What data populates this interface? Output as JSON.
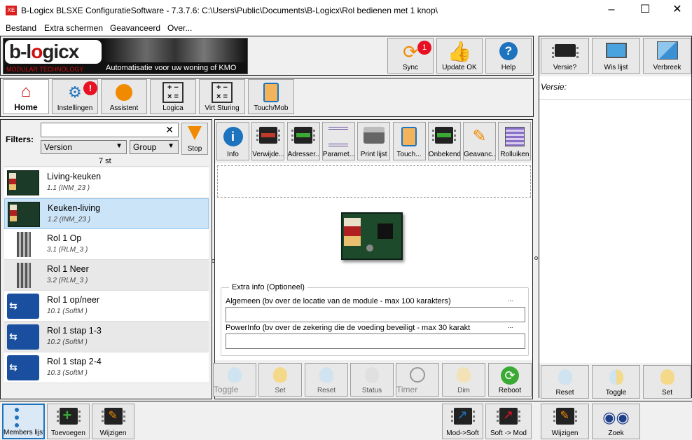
{
  "window": {
    "title": "B-Logicx BLSXE ConfiguratieSoftware - 7.3.7.6: C:\\Users\\Public\\Documents\\B-Logicx\\Rol bedienen met 1 knop\\",
    "icon": "XE",
    "minimize": "–",
    "maximize": "☐",
    "close": "✕"
  },
  "menu": [
    "Bestand",
    "Extra schermen",
    "Geavanceerd",
    "Over..."
  ],
  "logo": {
    "text": "b-l",
    "text2": "gicx",
    "subtitle": "MODULAR TECHNOLOGY",
    "slogan": "Automatisatie voor uw woning of KMO"
  },
  "topbuttons": {
    "sync": "Sync",
    "sync_badge": "1",
    "update": "Update OK",
    "help": "Help"
  },
  "rightbuttons": {
    "versie": "Versie?",
    "wis": "Wis lijst",
    "verbreek": "Verbreek"
  },
  "versie_label": "Versie:",
  "nav": {
    "home": "Home",
    "instellingen": "Instellingen",
    "assistent": "Assistent",
    "logica": "Logica",
    "virt": "Virt Sturing",
    "touch": "Touch/Mob",
    "badge": "!"
  },
  "filters": {
    "label": "Filters:",
    "search_value": "",
    "clear": "✕",
    "version": "Version",
    "group": "Group",
    "stop": "Stop",
    "count": "7 st"
  },
  "modules": [
    {
      "name": "Living-keuken",
      "sub": "1.1 (INM_23 )",
      "type": "inm"
    },
    {
      "name": "Keuken-living",
      "sub": "1.2 (INM_23 )",
      "type": "inm"
    },
    {
      "name": "Rol 1 Op",
      "sub": "3.1 (RLM_3 )",
      "type": "rlm"
    },
    {
      "name": "Rol 1 Neer",
      "sub": "3.2 (RLM_3 )",
      "type": "rlm"
    },
    {
      "name": "Rol 1 op/neer",
      "sub": "10.1 (SoftM )",
      "type": "soft"
    },
    {
      "name": "Rol 1 stap 1-3",
      "sub": "10.2 (SoftM )",
      "type": "soft"
    },
    {
      "name": "Rol 1 stap 2-4",
      "sub": "10.3 (SoftM )",
      "type": "soft"
    }
  ],
  "tools": [
    "Info",
    "Verwijde...",
    "Adresser...",
    "Paramet...",
    "Print lijst",
    "Touch...",
    "Onbekend",
    "Geavanc...",
    "Rolluiken"
  ],
  "extra": {
    "legend": "Extra info (Optioneel)",
    "algemeen": "Algemeen (bv over de locatie van de module - max 100 karakters)",
    "power": "PowerInfo (bv over de zekering die de voeding beveiligt - max 30 karakt",
    "dots": "...",
    "algemeen_value": "",
    "power_value": ""
  },
  "actions": {
    "toggle": "Toggle",
    "set": "Set",
    "reset": "Reset",
    "status": "Status",
    "timer": "Timer",
    "dim": "Dim",
    "reboot": "Reboot"
  },
  "rightactions": {
    "reset": "Reset",
    "toggle": "Toggle",
    "set": "Set"
  },
  "bottom": {
    "members": "Members lijst",
    "toevoegen": "Toevoegen",
    "wijzigen": "Wijzigen",
    "modsoft": "Mod->Soft",
    "softmod": "Soft -> Mod",
    "wijzigen2": "Wijzigen",
    "zoek": "Zoek"
  },
  "colors": {
    "selected": "#cce4f7",
    "badge": "#e81123",
    "accent": "#1e73be"
  }
}
